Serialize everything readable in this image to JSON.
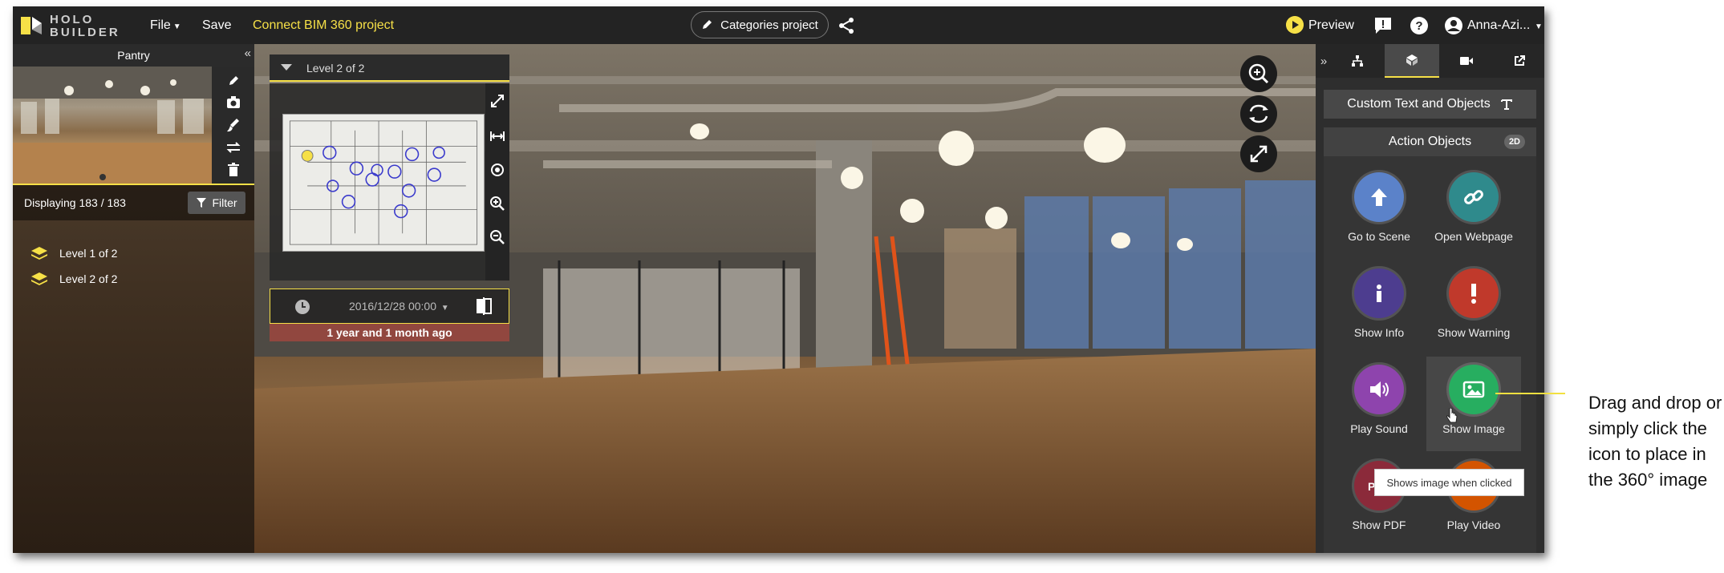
{
  "topbar": {
    "logo_text": "HOLO\nBUILDER",
    "file_label": "File",
    "save_label": "Save",
    "connect_label": "Connect BIM 360 project",
    "categories_label": "Categories project",
    "preview_label": "Preview",
    "user_label": "Anna-Azi..."
  },
  "left_panel": {
    "title": "Pantry",
    "displaying": "Displaying 183 / 183",
    "filter_label": "Filter",
    "levels": [
      {
        "label": "Level 1 of 2"
      },
      {
        "label": "Level 2 of 2"
      }
    ]
  },
  "minimap": {
    "level_label": "Level 2 of 2",
    "timestamp": "2016/12/28 00:00",
    "relative_time": "1 year and 1 month ago"
  },
  "right_panel": {
    "custom_text_label": "Custom Text and Objects",
    "action_objects_label": "Action Objects",
    "badge": "2D",
    "items": [
      {
        "label": "Go to Scene",
        "color": "#5b82c9",
        "icon": "arrow-up-icon"
      },
      {
        "label": "Open Webpage",
        "color": "#2f8a8c",
        "icon": "link-icon"
      },
      {
        "label": "Show Info",
        "color": "#4d3d8f",
        "icon": "info-icon"
      },
      {
        "label": "Show Warning",
        "color": "#c0392b",
        "icon": "warning-icon"
      },
      {
        "label": "Play Sound",
        "color": "#8e44ad",
        "icon": "speaker-icon"
      },
      {
        "label": "Show Image",
        "color": "#27ae60",
        "icon": "image-icon"
      },
      {
        "label": "Show PDF",
        "color": "#8b2a3a",
        "icon": "pdf-icon"
      },
      {
        "label": "Play Video",
        "color": "#d35400",
        "icon": "video-icon"
      }
    ],
    "tooltip": "Shows image when clicked"
  },
  "callout": {
    "text": "Drag and drop or simply click the icon to place in the 360° image"
  }
}
